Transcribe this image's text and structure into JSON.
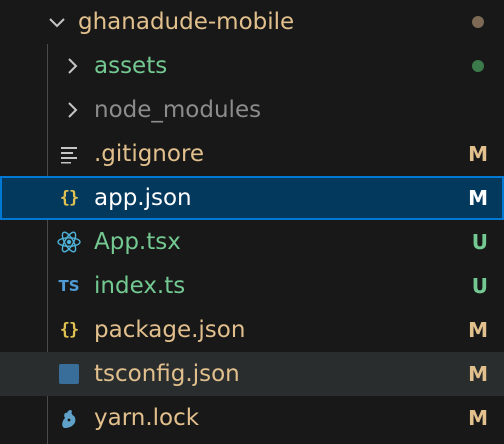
{
  "explorer": {
    "root": {
      "label": "ghanadude-mobile",
      "expanded": true,
      "status_dot_color": "#7c6a54"
    },
    "items": [
      {
        "label": "assets",
        "kind": "folder",
        "expanded": false,
        "label_color": "#73c991",
        "status": "",
        "status_dot_color": "#3b7a4a",
        "icon": "chevron-right-icon"
      },
      {
        "label": "node_modules",
        "kind": "folder",
        "expanded": false,
        "label_color": "#8c8c8c",
        "status": "",
        "icon": "chevron-right-icon"
      },
      {
        "label": ".gitignore",
        "kind": "file",
        "label_color": "#e2c08d",
        "status": "M",
        "status_color": "#e2c08d",
        "icon": "lines-icon"
      },
      {
        "label": "app.json",
        "kind": "file",
        "label_color": "#ffffff",
        "status": "M",
        "status_color": "#ffffff",
        "icon": "json-braces-icon",
        "selected": true
      },
      {
        "label": "App.tsx",
        "kind": "file",
        "label_color": "#73c991",
        "status": "U",
        "status_color": "#73c991",
        "icon": "react-icon"
      },
      {
        "label": "index.ts",
        "kind": "file",
        "label_color": "#73c991",
        "status": "U",
        "status_color": "#73c991",
        "icon": "ts-icon"
      },
      {
        "label": "package.json",
        "kind": "file",
        "label_color": "#e2c08d",
        "status": "M",
        "status_color": "#e2c08d",
        "icon": "json-braces-icon"
      },
      {
        "label": "tsconfig.json",
        "kind": "file",
        "label_color": "#e2c08d",
        "status": "M",
        "status_color": "#e2c08d",
        "icon": "tsconfig-icon",
        "hovered": true
      },
      {
        "label": "yarn.lock",
        "kind": "file",
        "label_color": "#e2c08d",
        "status": "M",
        "status_color": "#e2c08d",
        "icon": "yarn-icon"
      }
    ],
    "icon_glyphs": {
      "braces": "{}",
      "ts": "TS"
    }
  }
}
